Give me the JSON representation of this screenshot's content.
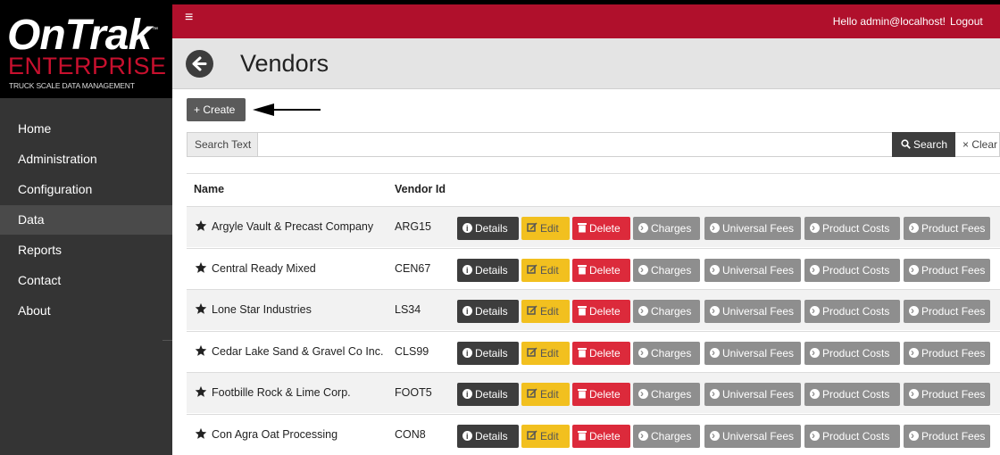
{
  "brand": {
    "main": "OnTrak",
    "tm": "™",
    "sub": "ENTERPRISE",
    "tagline": "TRUCK SCALE DATA MANAGEMENT"
  },
  "sidebar": {
    "items": [
      {
        "label": "Home"
      },
      {
        "label": "Administration"
      },
      {
        "label": "Configuration"
      },
      {
        "label": "Data"
      },
      {
        "label": "Reports"
      },
      {
        "label": "Contact"
      },
      {
        "label": "About"
      }
    ],
    "active": "Data"
  },
  "topbar": {
    "menu_icon": "≡",
    "greeting": "Hello admin@localhost!",
    "logout": "Logout"
  },
  "page": {
    "title": "Vendors",
    "create_label": "+ Create"
  },
  "search": {
    "prefix": "Search Text",
    "value": "",
    "search_label": "Search",
    "clear_label": "× Clear"
  },
  "table": {
    "headers": {
      "name": "Name",
      "vendor_id": "Vendor Id"
    },
    "rows": [
      {
        "name": "Argyle Vault & Precast Company",
        "id": "ARG15"
      },
      {
        "name": "Central Ready Mixed",
        "id": "CEN67"
      },
      {
        "name": "Lone Star Industries",
        "id": "LS34"
      },
      {
        "name": "Cedar Lake Sand & Gravel Co Inc.",
        "id": "CLS99"
      },
      {
        "name": "Footbille Rock & Lime Corp.",
        "id": "FOOT5"
      },
      {
        "name": "Con Agra Oat Processing",
        "id": "CON8"
      }
    ],
    "actions": {
      "details": "Details",
      "edit": "Edit",
      "delete": "Delete",
      "charges": "Charges",
      "universal_fees": "Universal Fees",
      "product_costs": "Product Costs",
      "product_fees": "Product Fees"
    }
  },
  "colors": {
    "brand_red": "#b0102c",
    "sidebar_bg": "#343434",
    "edit_yellow": "#f2c01f",
    "delete_red": "#dc2a3b",
    "secondary_gray": "#8e8e8e",
    "dark_btn": "#3d3d3d"
  }
}
